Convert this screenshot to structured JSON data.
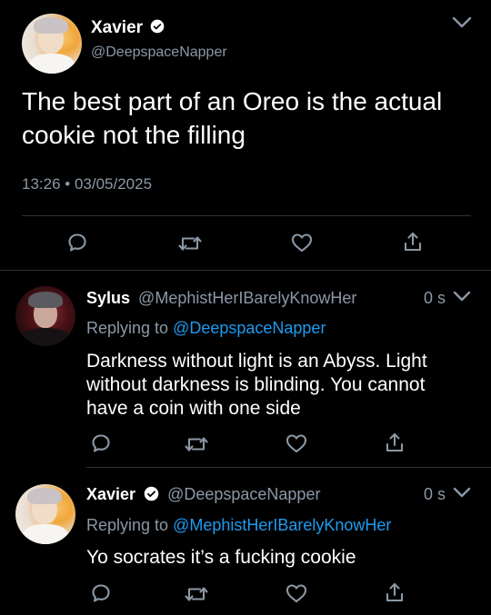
{
  "colors": {
    "background": "#000000",
    "text": "#ffffff",
    "muted": "#8b98a5",
    "link": "#1d9bf0",
    "divider": "#2f3336"
  },
  "main_tweet": {
    "display_name": "Xavier",
    "handle": "@DeepspaceNapper",
    "text_line1": "The best part of an Oreo is the actual",
    "text_line2": "cookie not the filling",
    "timestamp": "13:26 • 03/05/2025",
    "icons": [
      "reply-icon",
      "retweet-icon",
      "like-icon",
      "share-icon"
    ]
  },
  "replies": [
    {
      "display_name": "Sylus",
      "handle": "@MephistHerIBarelyKnowHer",
      "time": "0 s",
      "replying_prefix": "Replying to ",
      "replying_to": "@DeepspaceNapper",
      "text_line1": "Darkness without light is an Abyss. Light",
      "text_line2": "without darkness is blinding. You cannot",
      "text_line3": "have a coin with one side"
    },
    {
      "display_name": "Xavier",
      "handle": "@DeepspaceNapper",
      "time": "0 s",
      "replying_prefix": "Replying to ",
      "replying_to": "@MephistHerIBarelyKnowHer",
      "text_line1": "Yo socrates it’s a fucking cookie"
    }
  ]
}
